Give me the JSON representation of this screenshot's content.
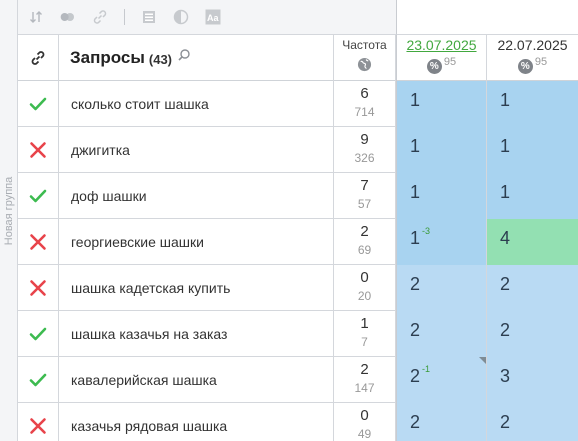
{
  "toolbar": {
    "icons": [
      "sort-icon",
      "toggle-icon",
      "link-icon",
      "table-icon",
      "contrast-icon",
      "text-size-icon"
    ]
  },
  "sidebar": {
    "group_label": "Новая группа"
  },
  "header": {
    "title": "Запросы",
    "count": "(43)",
    "frequency_label": "Частота",
    "dates": [
      {
        "label": "23.07.2025",
        "percent_badge": "%",
        "percent": "95"
      },
      {
        "label": "22.07.2025",
        "percent_badge": "%",
        "percent": "95"
      }
    ]
  },
  "colors": {
    "pos_light": "#b9daf3",
    "pos_mid": "#a8d3f0",
    "pos_green": "#93e0b2",
    "check": "#3dbb50",
    "cross": "#e8434a"
  },
  "rows": [
    {
      "status": "check",
      "query": "сколько стоит шашка",
      "freq": "6",
      "freq_global": "714",
      "pos1": "1",
      "pos1_delta": "",
      "pos2": "1",
      "c1": "mid",
      "c2": "mid"
    },
    {
      "status": "cross",
      "query": "джигитка",
      "freq": "9",
      "freq_global": "326",
      "pos1": "1",
      "pos1_delta": "",
      "pos2": "1",
      "c1": "mid",
      "c2": "mid"
    },
    {
      "status": "check",
      "query": "доф шашки",
      "freq": "7",
      "freq_global": "57",
      "pos1": "1",
      "pos1_delta": "",
      "pos2": "1",
      "c1": "mid",
      "c2": "mid"
    },
    {
      "status": "cross",
      "query": "георгиевские шашки",
      "freq": "2",
      "freq_global": "69",
      "pos1": "1",
      "pos1_delta": "-3",
      "pos2": "4",
      "c1": "mid",
      "c2": "green"
    },
    {
      "status": "cross",
      "query": "шашка кадетская купить",
      "freq": "0",
      "freq_global": "20",
      "pos1": "2",
      "pos1_delta": "",
      "pos2": "2",
      "c1": "light",
      "c2": "light"
    },
    {
      "status": "check",
      "query": "шашка казачья на заказ",
      "freq": "1",
      "freq_global": "7",
      "pos1": "2",
      "pos1_delta": "",
      "pos2": "2",
      "c1": "light",
      "c2": "light"
    },
    {
      "status": "check",
      "query": "кавалерийская шашка",
      "freq": "2",
      "freq_global": "147",
      "pos1": "2",
      "pos1_delta": "-1",
      "pos2": "3",
      "c1": "light",
      "c2": "light",
      "corner_mark": true
    },
    {
      "status": "cross",
      "query": "казачья рядовая шашка",
      "freq": "0",
      "freq_global": "49",
      "pos1": "2",
      "pos1_delta": "",
      "pos2": "2",
      "c1": "light",
      "c2": "light"
    }
  ]
}
